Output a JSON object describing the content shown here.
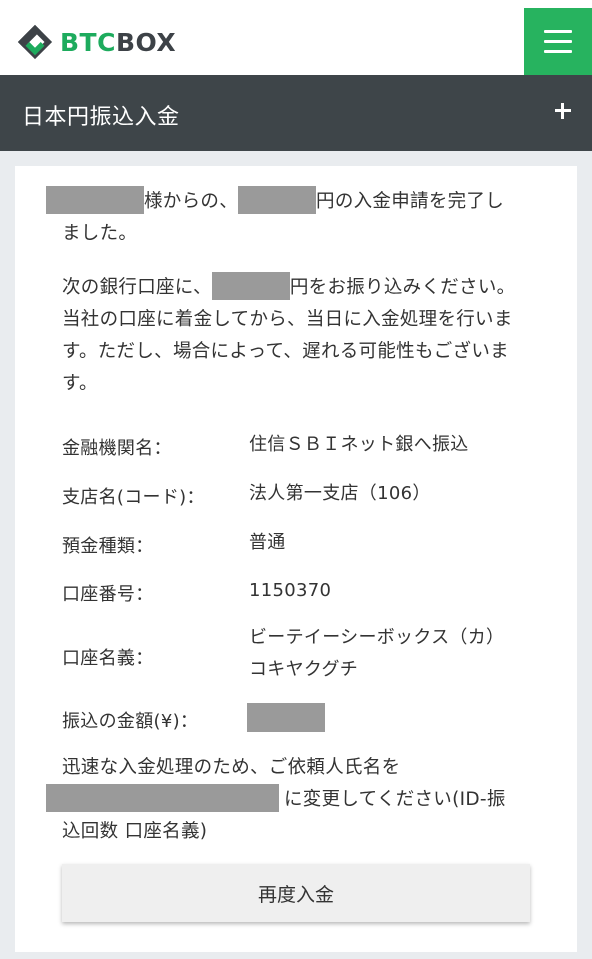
{
  "header": {
    "logo_btc": "BTC",
    "logo_box": "BOX",
    "menu_icon": "hamburger-menu-icon"
  },
  "section": {
    "title": "日本円振込入金",
    "toggle_icon": "plus-icon"
  },
  "message": {
    "p1_part1": "様からの、",
    "p1_part2": "円の入金申請を完了し",
    "p1_part3": "ました。",
    "p2_part1": "次の銀行口座に、",
    "p2_part2": "円をお振り込みくださ",
    "p2_rest": "い。当社の口座に着金してから、当日に入金処理を行います。ただし、場合によって、遅れる可能性もございます。"
  },
  "bank": {
    "rows": [
      {
        "label": "金融機関名：",
        "value": "住信ＳＢＩネット銀へ振込"
      },
      {
        "label": "支店名(コード)：",
        "value": "法人第一支店（106）"
      },
      {
        "label": "預金種類：",
        "value": "普通"
      },
      {
        "label": "口座番号：",
        "value": "1150370"
      },
      {
        "label": "口座名義：",
        "value_line1": "ビーテイーシーボックス（カ）",
        "value_line2": "コキヤクグチ"
      },
      {
        "label": "振込の金額(¥)："
      }
    ]
  },
  "instruction": {
    "line1": "迅速な入金処理のため、ご依頼人氏名を",
    "line2_after": "に変更してください(ID-振",
    "line3": "込回数 口座名義)"
  },
  "actions": {
    "redeposit_label": "再度入金"
  }
}
